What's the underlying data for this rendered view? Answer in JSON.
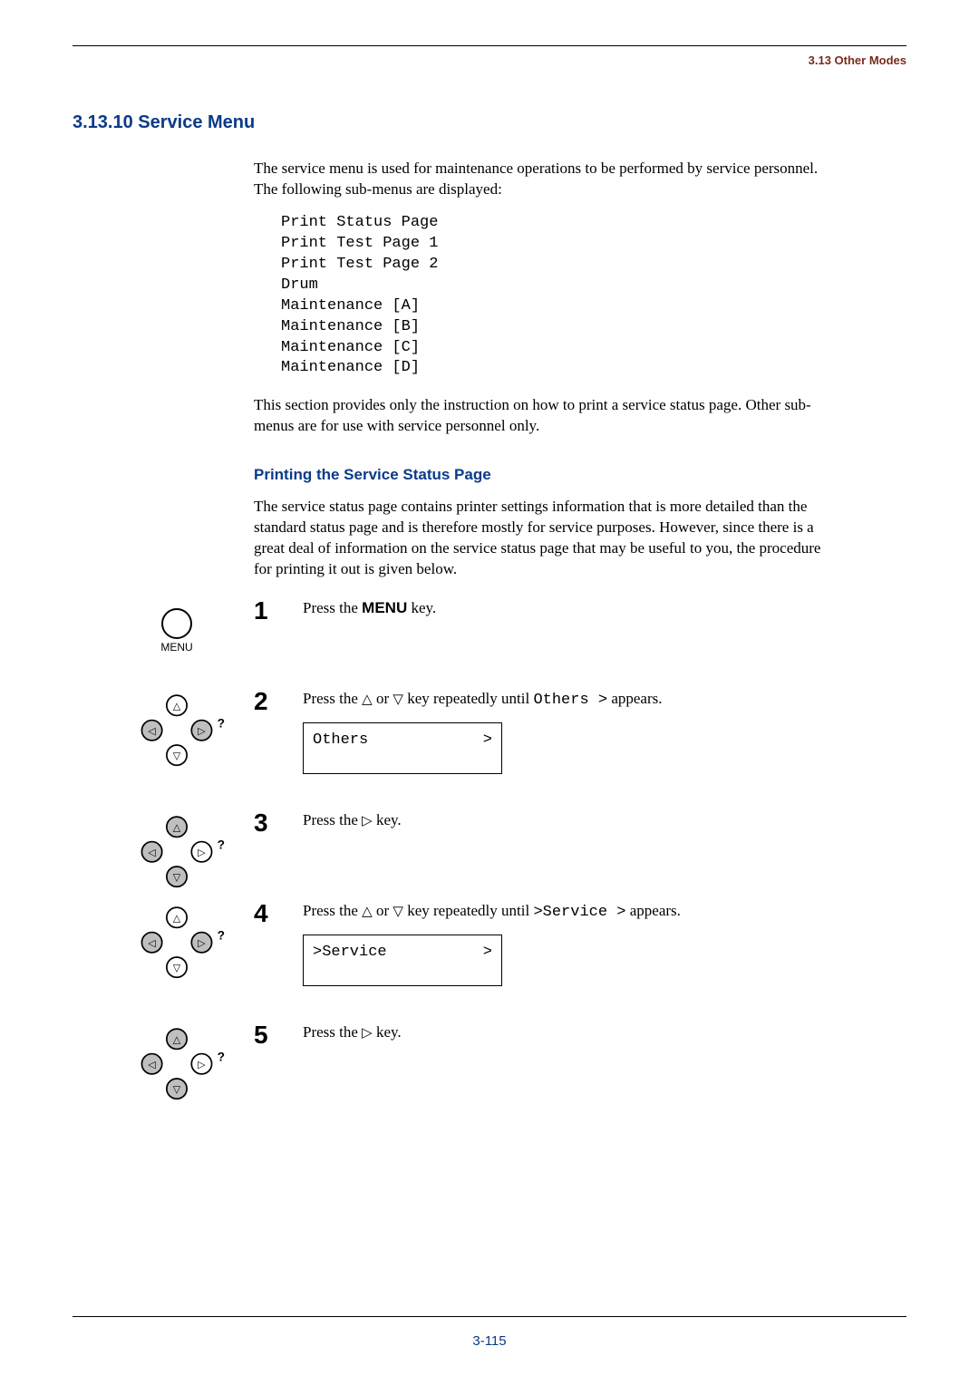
{
  "header": {
    "breadcrumb": "3.13 Other Modes"
  },
  "section": {
    "number": "3.13.10",
    "title": "Service Menu",
    "intro": "The service menu is used for maintenance operations to be performed by service personnel. The following sub-menus are displayed:",
    "menu_items": "Print Status Page\nPrint Test Page 1\nPrint Test Page 2\nDrum\nMaintenance [A]\nMaintenance [B]\nMaintenance [C]\nMaintenance [D]",
    "note": "This section provides only the instruction on how to print a service status page. Other sub-menus are for use with service personnel only.",
    "subheading": "Printing the Service Status Page",
    "subintro": "The service status page contains printer settings information that is more detailed than the standard status page and is therefore mostly for service purposes. However, since there is a great deal of information on the service status page that may be useful to you, the procedure for printing it out is given below."
  },
  "steps": [
    {
      "num": "1",
      "text_pre": "Press the ",
      "key_bold": "MENU",
      "text_post": " key."
    },
    {
      "num": "2",
      "text_pre": "Press the ",
      "tri1": "△",
      "mid": " or ",
      "tri2": "▽",
      "text_post_a": " key repeatedly until ",
      "mono_inline": "Others  >",
      "text_post_b": " appears.",
      "lcd_left": "Others",
      "lcd_right": ">"
    },
    {
      "num": "3",
      "text_pre": "Press the ",
      "tri1": "▷",
      "text_post": " key."
    },
    {
      "num": "4",
      "text_pre": "Press the ",
      "tri1": "△",
      "mid": " or ",
      "tri2": "▽",
      "text_post_a": " key repeatedly until ",
      "mono_inline": ">Service  >",
      "text_post_b": " appears.",
      "lcd_left": ">Service",
      "lcd_right": ">"
    },
    {
      "num": "5",
      "text_pre": "Press the ",
      "tri1": "▷",
      "text_post": " key."
    }
  ],
  "icons": {
    "menu_label": "MENU"
  },
  "footer": {
    "page_num": "3-115"
  }
}
